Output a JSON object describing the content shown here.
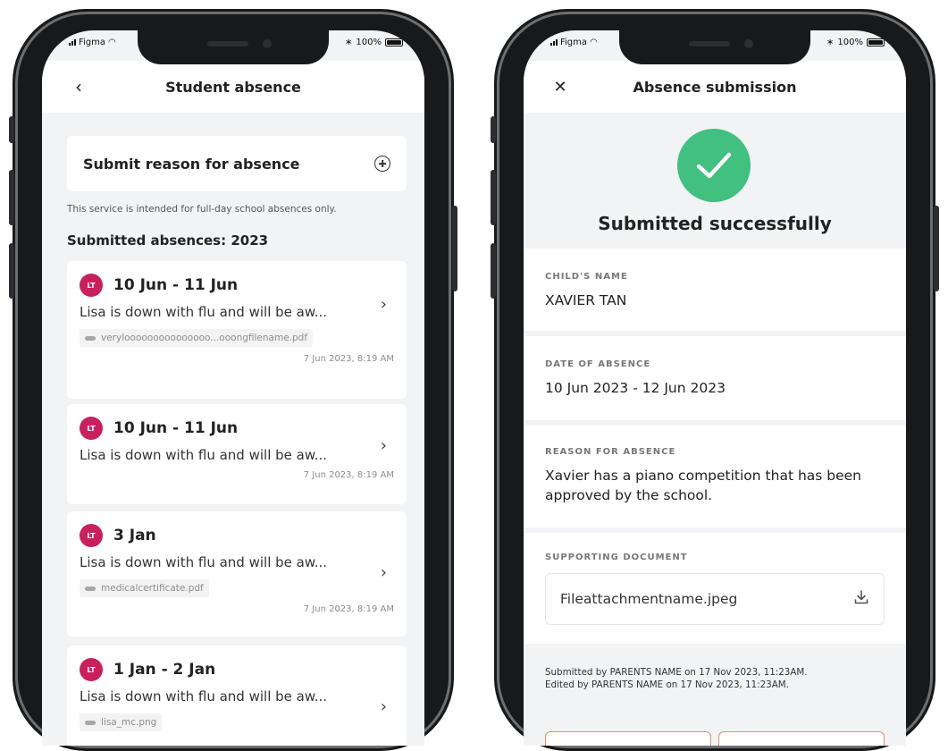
{
  "left_screen": {
    "status": {
      "carrier": "Figma",
      "battery": "100%"
    },
    "nav": {
      "title": "Student absence",
      "back_symbol": "‹"
    },
    "submit_card": {
      "label": "Submit reason for absence"
    },
    "service_note": "This service is intended for full-day school absences only.",
    "section_heading": "Submitted absences: 2023",
    "absences": [
      {
        "avatar": "LT",
        "dates": "10 Jun - 11 Jun",
        "reason": "Lisa is down with flu and will be aw...",
        "file": "verylooooooooooooooo...ooongfilename.pdf",
        "timestamp": "7 Jun 2023, 8:19 AM"
      },
      {
        "avatar": "LT",
        "dates": "10 Jun - 11 Jun",
        "reason": "Lisa is down with flu and will be aw...",
        "file": "",
        "timestamp": "7 Jun 2023, 8:19 AM"
      },
      {
        "avatar": "LT",
        "dates": "3 Jan",
        "reason": "Lisa is down with flu and will be aw...",
        "file": "medicalcertificate.pdf",
        "timestamp": "7 Jun 2023, 8:19 AM"
      },
      {
        "avatar": "LT",
        "dates": "1 Jan - 2 Jan",
        "reason": "Lisa is down with flu and will be aw...",
        "file": "lisa_mc.png",
        "timestamp": ""
      }
    ]
  },
  "right_screen": {
    "status": {
      "carrier": "Figma",
      "battery": "100%"
    },
    "nav": {
      "title": "Absence submission",
      "close_symbol": "✕"
    },
    "success": {
      "message": "Submitted successfully"
    },
    "child_name": {
      "label": "CHILD'S NAME",
      "value": "XAVIER TAN"
    },
    "date_of_absence": {
      "label": "DATE OF ABSENCE",
      "value": "10 Jun 2023 - 12 Jun 2023"
    },
    "reason_for_absence": {
      "label": "REASON FOR ABSENCE",
      "value": "Xavier has a piano competition that has been approved by the school."
    },
    "supporting_document": {
      "label": "SUPPORTING DOCUMENT",
      "file": "Fileattachmentname.jpeg"
    },
    "footer": {
      "submitted_line": "Submitted by PARENTS NAME on 17 Nov 2023, 11:23AM.",
      "edited_line": "Edited by PARENTS NAME on 17 Nov 2023, 11:23AM."
    }
  },
  "colors": {
    "avatar": "#c8205f",
    "success": "#41c07f",
    "button_border": "#e88a6c",
    "background": "#f1f3f5"
  }
}
